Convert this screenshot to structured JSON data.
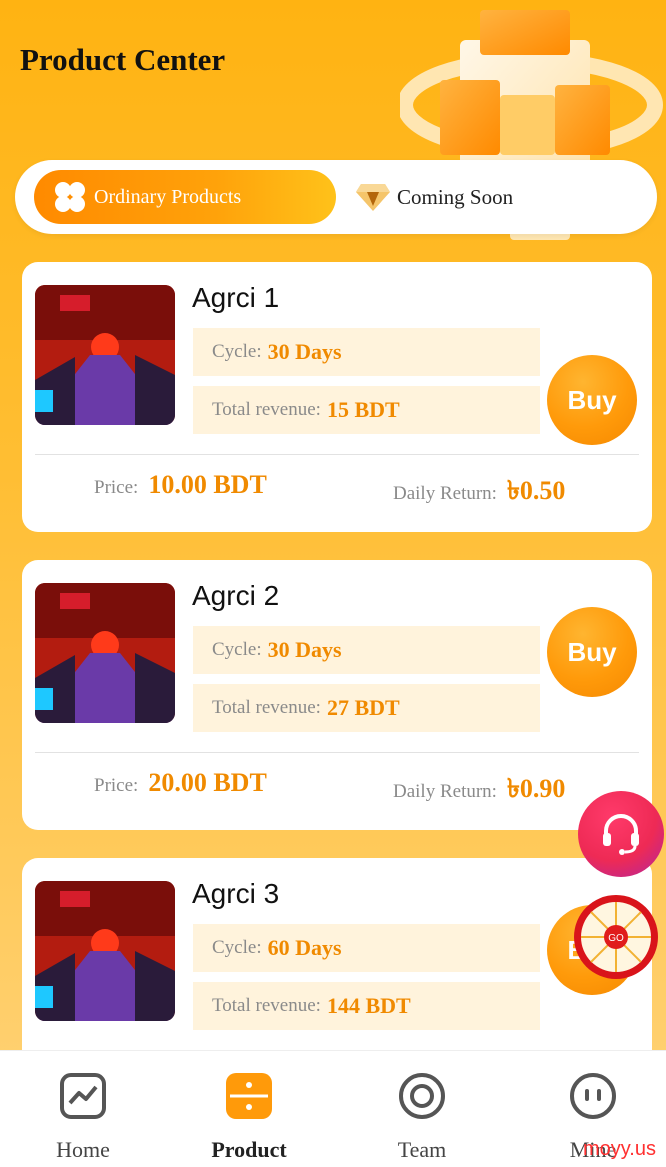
{
  "header": {
    "title": "Product Center"
  },
  "tabs": [
    {
      "label": "Ordinary Products",
      "active": true,
      "icon": "clover-icon"
    },
    {
      "label": "Coming Soon",
      "active": false,
      "icon": "diamond-icon"
    }
  ],
  "products": [
    {
      "name": "Agrci 1",
      "cycle_label": "Cycle:",
      "cycle_value": "30 Days",
      "revenue_label": "Total revenue:",
      "revenue_value": "15 BDT",
      "buy_label": "Buy",
      "price_label": "Price:",
      "price_value": "10.00 BDT",
      "daily_label": "Daily Return:",
      "daily_value": "৳0.50"
    },
    {
      "name": "Agrci 2",
      "cycle_label": "Cycle:",
      "cycle_value": "30 Days",
      "revenue_label": "Total revenue:",
      "revenue_value": "27 BDT",
      "buy_label": "Buy",
      "price_label": "Price:",
      "price_value": "20.00 BDT",
      "daily_label": "Daily Return:",
      "daily_value": "৳0.90"
    },
    {
      "name": "Agrci 3",
      "cycle_label": "Cycle:",
      "cycle_value": "60 Days",
      "revenue_label": "Total revenue:",
      "revenue_value": "144 BDT",
      "buy_label": "Buy"
    }
  ],
  "fab": {
    "wheel_label": "GO"
  },
  "nav": [
    {
      "label": "Home",
      "icon": "chart-line-icon"
    },
    {
      "label": "Product",
      "icon": "product-grid-icon",
      "active": true
    },
    {
      "label": "Team",
      "icon": "target-icon"
    },
    {
      "label": "Mine",
      "icon": "face-icon"
    }
  ],
  "watermark": "moyy.us",
  "colors": {
    "accent": "#ff9a0a",
    "background": "#ffb312",
    "value_text": "#f08a00"
  }
}
